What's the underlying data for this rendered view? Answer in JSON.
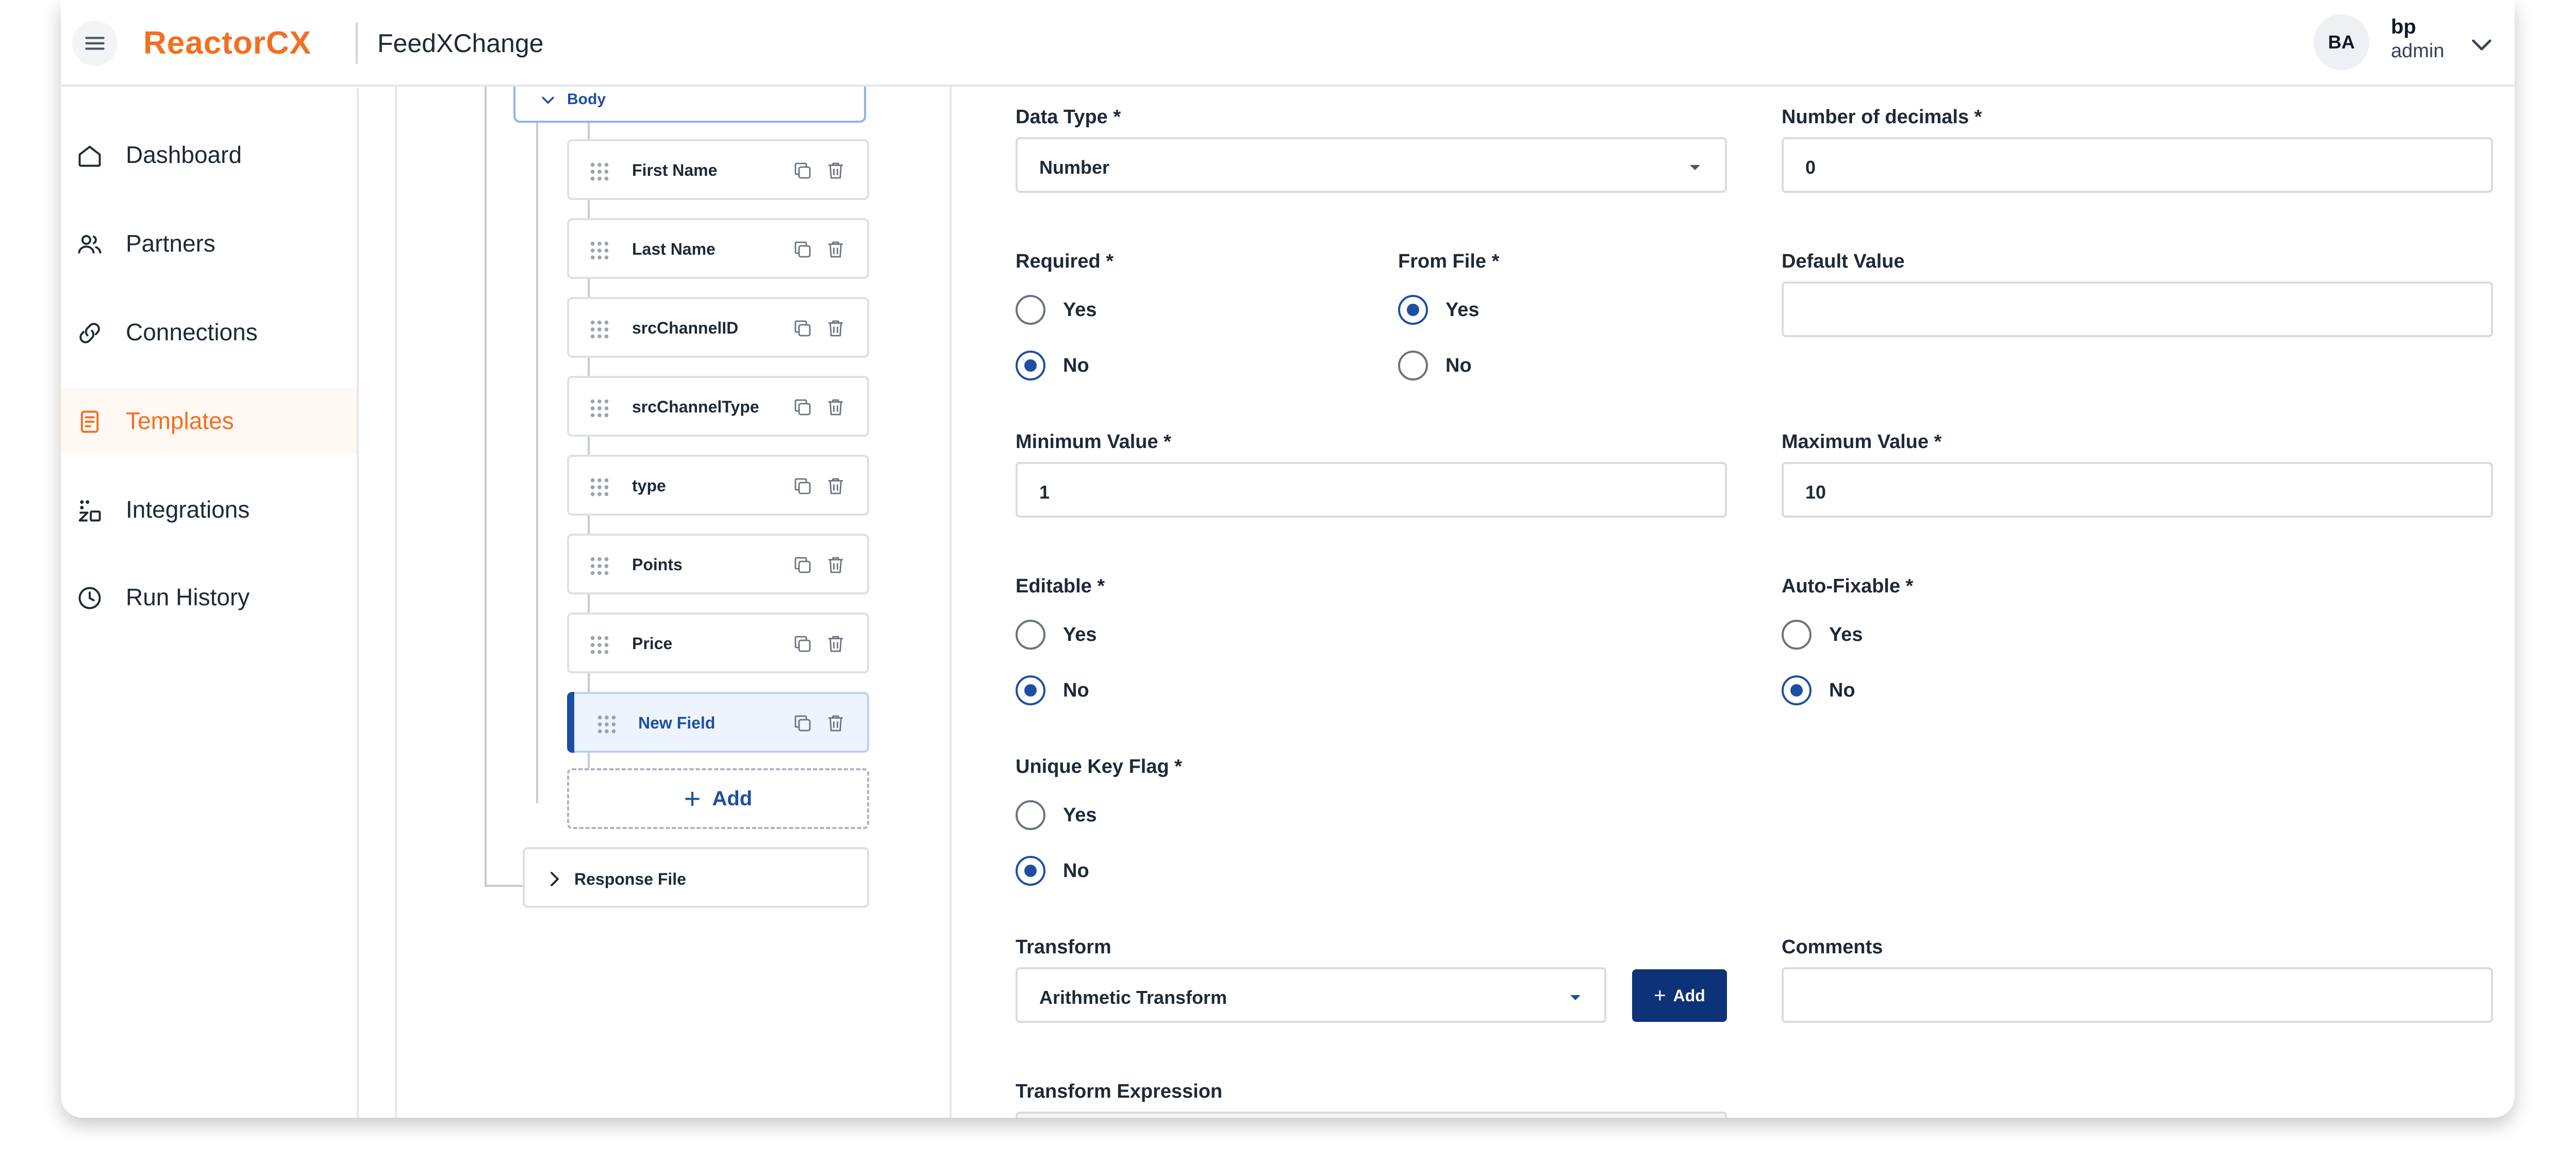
{
  "header": {
    "brand": "ReactorCX",
    "app_name": "FeedXChange",
    "user_initials": "BA",
    "user_name": "bp",
    "user_role": "admin"
  },
  "sidebar": {
    "items": [
      {
        "label": "Dashboard",
        "icon": "home-icon",
        "active": false
      },
      {
        "label": "Partners",
        "icon": "users-icon",
        "active": false
      },
      {
        "label": "Connections",
        "icon": "link-icon",
        "active": false
      },
      {
        "label": "Templates",
        "icon": "document-icon",
        "active": true
      },
      {
        "label": "Integrations",
        "icon": "integrations-icon",
        "active": false
      },
      {
        "label": "Run History",
        "icon": "history-icon",
        "active": false
      }
    ]
  },
  "tree": {
    "body_label": "Body",
    "fields": [
      "First Name",
      "Last Name",
      "srcChannelID",
      "srcChannelType",
      "type",
      "Points",
      "Price",
      "New Field"
    ],
    "selected_field": "New Field",
    "add_label": "Add",
    "response_label": "Response File"
  },
  "form": {
    "data_type": {
      "label": "Data Type *",
      "value": "Number"
    },
    "decimals": {
      "label": "Number of decimals *",
      "value": "0"
    },
    "required": {
      "label": "Required *",
      "yes": "Yes",
      "no": "No",
      "selected": "No"
    },
    "from_file": {
      "label": "From File *",
      "yes": "Yes",
      "no": "No",
      "selected": "Yes"
    },
    "default_value": {
      "label": "Default Value",
      "value": ""
    },
    "min_value": {
      "label": "Minimum Value *",
      "value": "1"
    },
    "max_value": {
      "label": "Maximum Value *",
      "value": "10"
    },
    "editable": {
      "label": "Editable *",
      "yes": "Yes",
      "no": "No",
      "selected": "No"
    },
    "auto_fixable": {
      "label": "Auto-Fixable *",
      "yes": "Yes",
      "no": "No",
      "selected": "No"
    },
    "unique_key": {
      "label": "Unique Key Flag *",
      "yes": "Yes",
      "no": "No",
      "selected": "No"
    },
    "transform": {
      "label": "Transform",
      "value": "Arithmetic Transform",
      "add_label": "Add"
    },
    "comments": {
      "label": "Comments",
      "value": ""
    },
    "transform_expression": {
      "label": "Transform Expression"
    }
  },
  "colors": {
    "brand_orange": "#f36f21",
    "primary_blue": "#1d4ea3",
    "button_navy": "#0d3277"
  }
}
